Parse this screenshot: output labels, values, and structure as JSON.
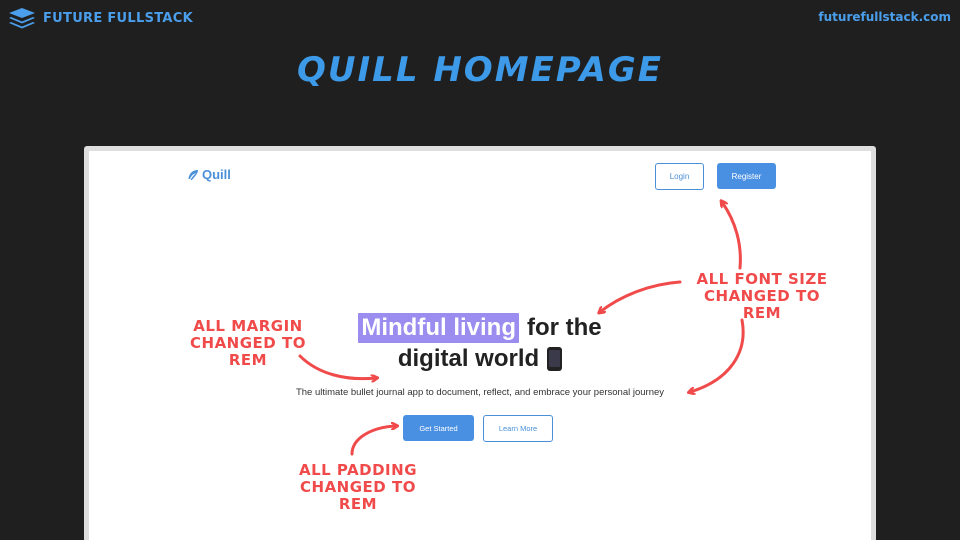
{
  "header": {
    "brand_name": "FUTURE FULLSTACK",
    "site_url": "futurefullstack.com",
    "brand_icon": "stacked-layers-icon"
  },
  "slide_title": "QUILL HOMEPAGE",
  "website": {
    "logo_text": "Quill",
    "logo_icon": "feather-icon",
    "nav": {
      "login_label": "Login",
      "register_label": "Register"
    },
    "hero": {
      "highlight_text": "Mindful living",
      "line1_rest": "for the",
      "line2": "digital world",
      "emoji_icon": "mobile-phone-icon",
      "tagline": "The ultimate bullet journal app to document, reflect, and embrace your personal journey"
    },
    "cta": {
      "primary_label": "Get Started",
      "secondary_label": "Learn More"
    }
  },
  "annotations": {
    "font_size": [
      "ALL FONT SIZE",
      "CHANGED TO REM"
    ],
    "margin": [
      "ALL MARGIN",
      "CHANGED TO REM"
    ],
    "padding": [
      "ALL PADDING",
      "CHANGED TO REM"
    ]
  },
  "colors": {
    "background": "#1f1f1f",
    "accent": "#4a9eeb",
    "annotation": "#f04a4a",
    "highlight": "#9b8cf0"
  }
}
